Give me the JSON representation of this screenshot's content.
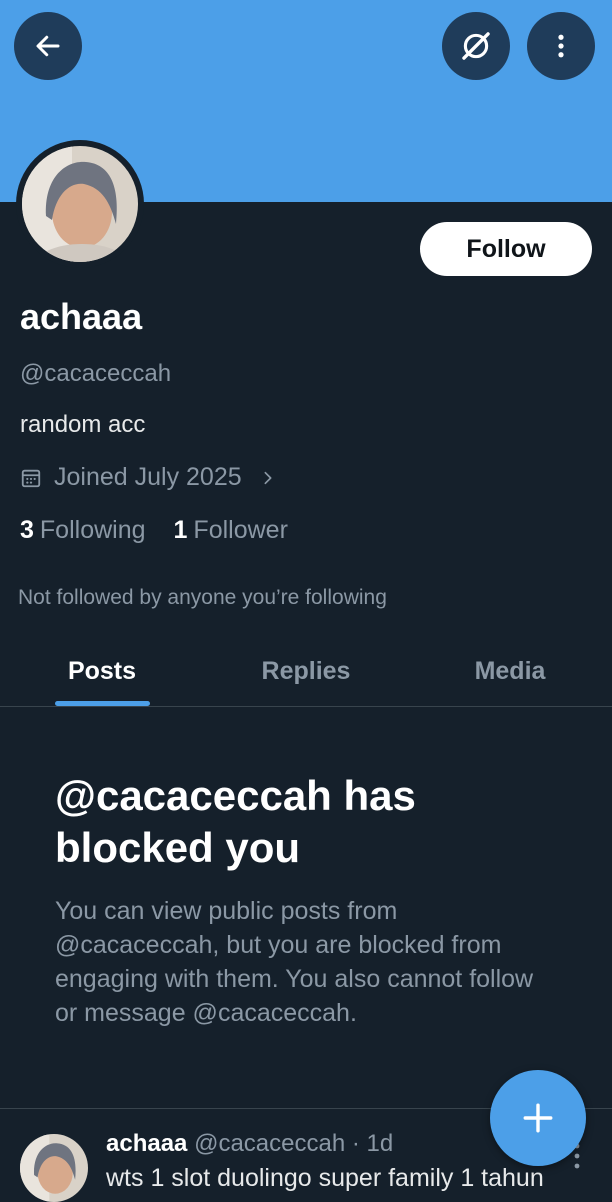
{
  "header": {
    "back_icon": "arrow-left-icon",
    "grok_icon": "grok-icon",
    "more_icon": "more-vertical-icon",
    "banner_color": "#4c9fe8"
  },
  "profile": {
    "follow_label": "Follow",
    "name": "achaaa",
    "handle": "@cacaceccah",
    "bio": "random acc",
    "joined": "Joined July 2025",
    "following_count": "3",
    "following_label": "Following",
    "followers_count": "1",
    "followers_label": "Follower",
    "not_followed": "Not followed by anyone you’re following"
  },
  "tabs": [
    {
      "label": "Posts",
      "active": true
    },
    {
      "label": "Replies",
      "active": false
    },
    {
      "label": "Media",
      "active": false
    }
  ],
  "blocked": {
    "title": "@cacaceccah has blocked you",
    "description": "You can view public posts from @cacaceccah, but you are blocked from engaging with them. You also cannot follow or message @cacaceccah."
  },
  "post": {
    "name": "achaaa",
    "handle": "@cacaceccah",
    "time": "· 1d",
    "text": "wts 1 slot duolingo super family 1 tahun"
  },
  "fab": {
    "icon": "plus-icon",
    "color": "#4c9fe8"
  }
}
